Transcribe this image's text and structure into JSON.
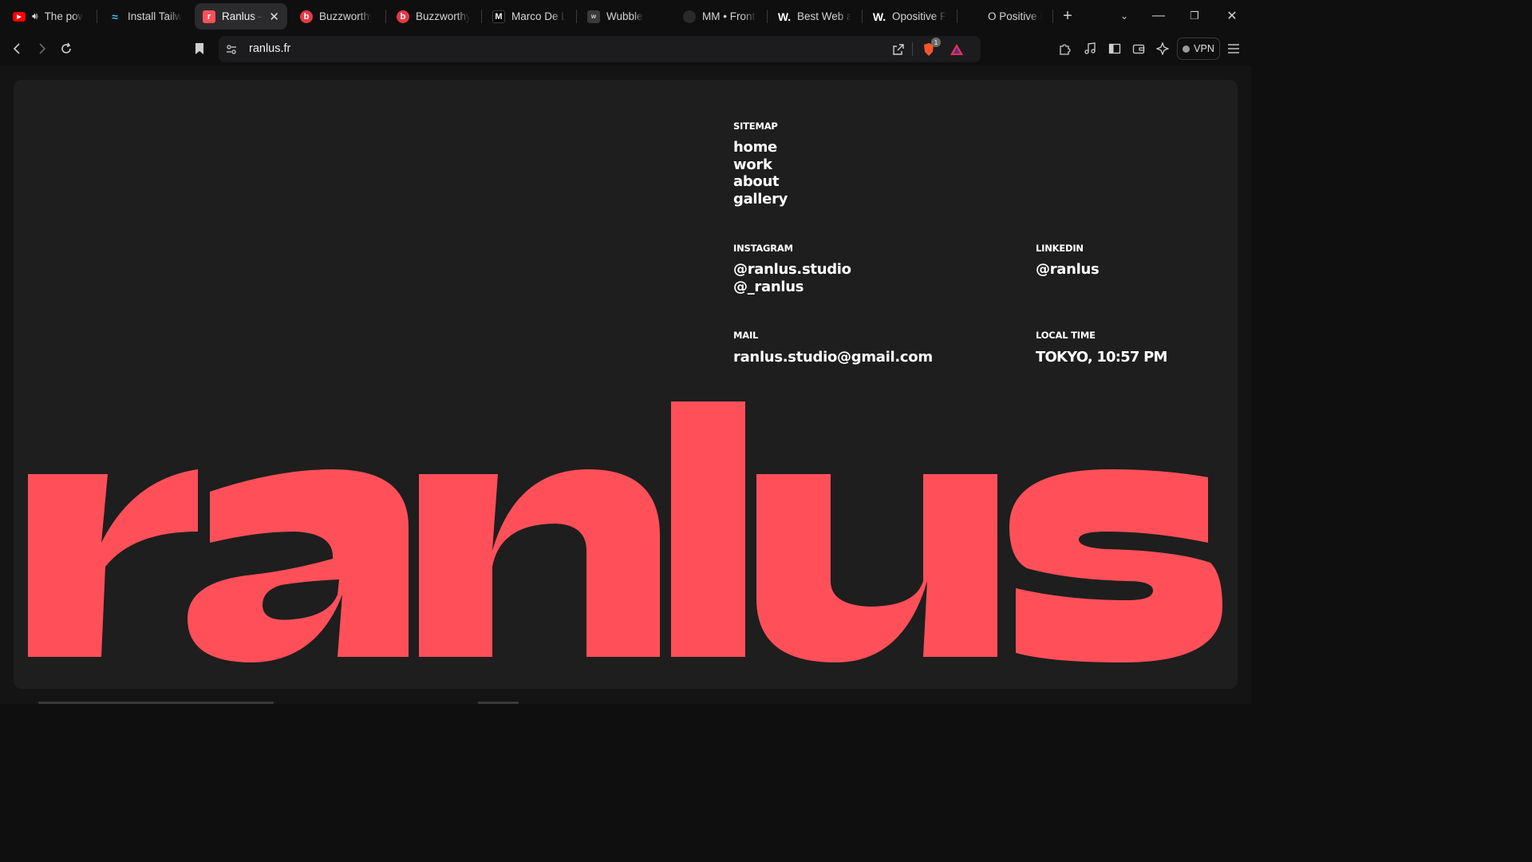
{
  "browser": {
    "tabs": [
      {
        "title": "The power",
        "favicon": "youtube-icon",
        "audio": true
      },
      {
        "title": "Install Tailwind",
        "favicon": "tailwind-icon"
      },
      {
        "title": "Ranlus –",
        "favicon": "ranlus-icon",
        "active": true
      },
      {
        "title": "Buzzworthy S",
        "favicon": "buzzworthy-icon"
      },
      {
        "title": "Buzzworthy S",
        "favicon": "buzzworthy-icon"
      },
      {
        "title": "Marco De Lu",
        "favicon": "marco-icon"
      },
      {
        "title": "Wubble",
        "favicon": "wubble-icon"
      },
      {
        "title": "MM • Fronte",
        "favicon": "mm-icon"
      },
      {
        "title": "Best Web an",
        "favicon": "w-icon"
      },
      {
        "title": "Opositive Fil",
        "favicon": "w-icon"
      },
      {
        "title": "O Positive Fil",
        "favicon": "blank-icon"
      }
    ],
    "url": "ranlus.fr",
    "vpn_label": "VPN",
    "shield_badge": "1"
  },
  "page": {
    "sitemap": {
      "label": "SITEMAP",
      "links": [
        "home",
        "work",
        "about",
        "gallery"
      ]
    },
    "instagram": {
      "label": "INSTAGRAM",
      "handles": [
        "@ranlus.studio",
        "@_ranlus"
      ]
    },
    "linkedin": {
      "label": "LINKEDIN",
      "handle": "@ranlus"
    },
    "mail": {
      "label": "MAIL",
      "address": "ranlus.studio@gmail.com"
    },
    "local_time": {
      "label": "LOCAL TIME",
      "value": "TOKYO, 10:57 PM"
    },
    "wordmark": "ranlus"
  },
  "colors": {
    "accent": "#ff5059",
    "card_bg": "#1e1e1e",
    "text": "#ffffff"
  }
}
